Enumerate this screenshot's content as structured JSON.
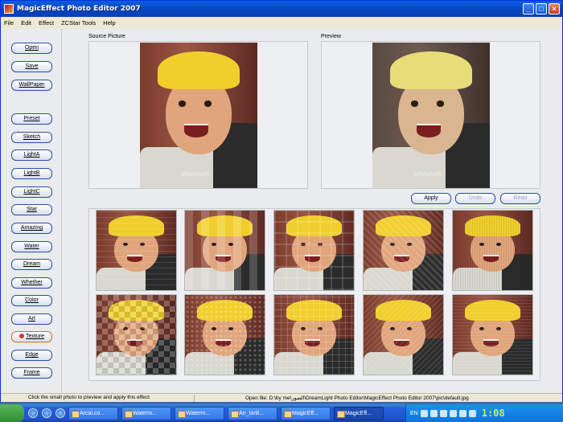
{
  "window": {
    "title": "MagicEffect Photo Editor 2007"
  },
  "menu": [
    "File",
    "Edit",
    "Effect",
    "ZCStar Tools",
    "Help"
  ],
  "left_buttons": [
    "Open",
    "Save",
    "WallPaper",
    "Preset",
    "Sketch",
    "LightA",
    "LightB",
    "LightC",
    "Star",
    "Amazing",
    "Water",
    "Dream",
    "Whether",
    "Color",
    "Art",
    "Texture",
    "Edge",
    "Frame"
  ],
  "active_button": "Texture",
  "panes": {
    "source_label": "Source Picture",
    "preview_label": "Preview",
    "watermark": "alfahriyah"
  },
  "actions": {
    "apply": "Apply",
    "undo": "Undo",
    "redo": "Redo"
  },
  "thumbnails": {
    "rows": 2,
    "cols": 5,
    "effects": [
      "texture-1",
      "texture-2",
      "texture-3",
      "texture-4",
      "texture-5",
      "texture-6",
      "texture-7",
      "texture-8",
      "texture-9",
      "texture-10"
    ]
  },
  "status": {
    "hint": "Click the small photo to preview and apply this effect",
    "file": "Open file: D:\\by me\\الصور\\DreamLight Photo Editor\\MagicEffect Photo Editor 2007\\pic\\default.jpg"
  },
  "taskbar": {
    "tasks": [
      "Arcai.co...",
      "Waterm...",
      "Waterm...",
      "An_Ionli...",
      "MagicEff...",
      "MagicEff..."
    ],
    "active_task_index": 5,
    "language": "EN",
    "clock": "1:08"
  },
  "colors": {
    "titlebar": "#0848c4",
    "button_border": "#2a4da8",
    "hat": "#f0cf2d",
    "taskbar": "#245edb"
  }
}
